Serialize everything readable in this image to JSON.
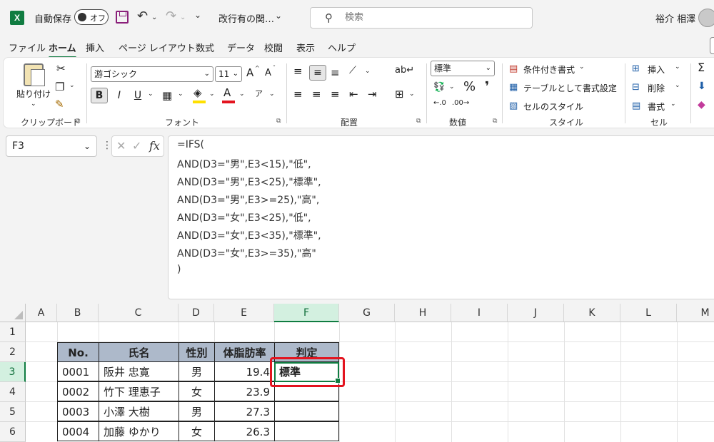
{
  "titlebar": {
    "app_icon": "excel-logo-icon",
    "app_letter": "X",
    "autosave_label": "自動保存",
    "autosave_state": "オフ",
    "undo_glyph": "↶",
    "redo_glyph": "↷",
    "qat_glyph": "⌄",
    "doc_title": "改行有の関…",
    "doc_title_chevron": "⌄",
    "search_placeholder": "検索",
    "user_name": "裕介 相澤"
  },
  "menu": {
    "tabs": [
      "ファイル",
      "ホーム",
      "挿入",
      "ページ レイアウト",
      "数式",
      "データ",
      "校閲",
      "表示",
      "ヘルプ"
    ],
    "active": "ホーム"
  },
  "ribbon": {
    "clipboard": {
      "paste": "貼り付け",
      "label": "クリップボード"
    },
    "font": {
      "name": "游ゴシック",
      "size": "11",
      "grow": "A",
      "shrink": "A",
      "bold": "B",
      "italic": "I",
      "underline": "U",
      "label": "フォント",
      "font_color": "#e3141f",
      "fill_color": "#ffe000"
    },
    "alignment": {
      "label": "配置"
    },
    "number": {
      "format": "標準",
      "percent": "%",
      "comma": "❜",
      "label": "数値"
    },
    "styles": {
      "conditional": "条件付き書式",
      "table": "テーブルとして書式設定",
      "cell_styles": "セルのスタイル",
      "label": "スタイル"
    },
    "cells": {
      "insert": "挿入",
      "delete": "削除",
      "format": "書式",
      "label": "セル"
    },
    "editing": {
      "sum": "Σ"
    }
  },
  "formula_bar": {
    "name_box": "F3",
    "fx": "fx",
    "lines": [
      "=IFS(",
      "AND(D3=\"男\",E3<15),\"低\",",
      "AND(D3=\"男\",E3<25),\"標準\",",
      "AND(D3=\"男\",E3>=25),\"高\",",
      "AND(D3=\"女\",E3<25),\"低\",",
      "AND(D3=\"女\",E3<35),\"標準\",",
      "AND(D3=\"女\",E3>=35),\"高\"",
      ")"
    ]
  },
  "grid": {
    "columns": [
      "A",
      "B",
      "C",
      "D",
      "E",
      "F",
      "G",
      "H",
      "I",
      "J",
      "K",
      "L",
      "M"
    ],
    "rows": [
      "1",
      "2",
      "3",
      "4",
      "5",
      "6"
    ],
    "selected_column": "F",
    "selected_row": "3",
    "table": {
      "headers": [
        "No.",
        "氏名",
        "性別",
        "体脂肪率",
        "判定"
      ],
      "rows": [
        [
          "0001",
          "阪井 忠寛",
          "男",
          "19.4",
          "標準"
        ],
        [
          "0002",
          "竹下 理恵子",
          "女",
          "23.9",
          ""
        ],
        [
          "0003",
          "小澤 大樹",
          "男",
          "27.3",
          ""
        ],
        [
          "0004",
          "加藤 ゆかり",
          "女",
          "26.3",
          ""
        ]
      ]
    },
    "highlight_color": "#e3141f"
  }
}
